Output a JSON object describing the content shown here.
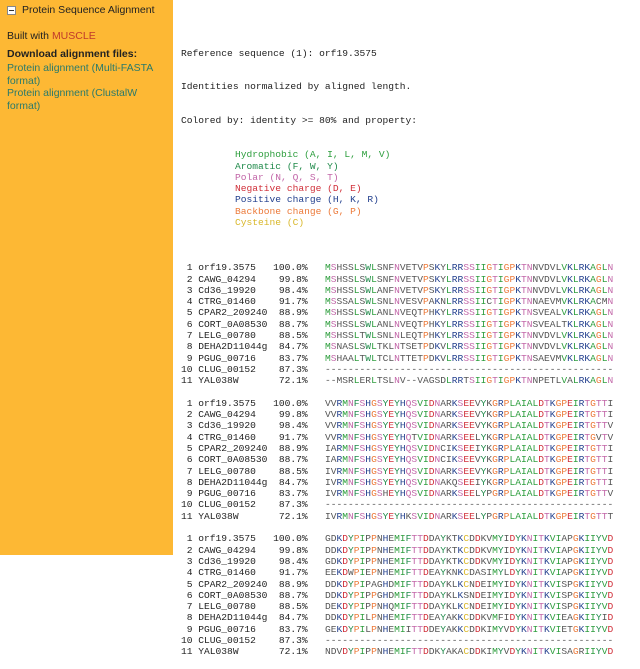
{
  "sidebar": {
    "title": "Protein Sequence Alignment",
    "built_with_prefix": "Built with ",
    "built_with_tool": "MUSCLE",
    "download_heading": "Download alignment files:",
    "links": [
      "Protein alignment (Multi-FASTA format)",
      "Protein alignment (ClustalW format)"
    ]
  },
  "header": {
    "reference": "Reference sequence (1): orf19.3575",
    "normalized": "Identities normalized by aligned length.",
    "colored_by": "Colored by: identity >= 80% and property:"
  },
  "legend": [
    {
      "label": "Hydrophobic (A, I, L, M, V)",
      "color": "#2e9e3e",
      "residues": "AILMV"
    },
    {
      "label": "Aromatic (F, W, Y)",
      "color": "#1f8a4a",
      "residues": "FWY"
    },
    {
      "label": "Polar (N, Q, S, T)",
      "color": "#c266a8",
      "residues": "NQST"
    },
    {
      "label": "Negative charge (D, E)",
      "color": "#d0303a",
      "residues": "DE"
    },
    {
      "label": "Positive charge (H, K, R)",
      "color": "#23408e",
      "residues": "HKR"
    },
    {
      "label": "Backbone change (G, P)",
      "color": "#ec7a3a",
      "residues": "GP"
    },
    {
      "label": "Cysteine (C)",
      "color": "#d9b82b",
      "residues": "C"
    }
  ],
  "default_color": "#555555",
  "identity_threshold": 0.8,
  "sequences": [
    {
      "num": "1",
      "name": "orf19.3575",
      "identity": "100.0%"
    },
    {
      "num": "2",
      "name": "CAWG_04294",
      "identity": "99.8%"
    },
    {
      "num": "3",
      "name": "Cd36_19920",
      "identity": "98.4%"
    },
    {
      "num": "4",
      "name": "CTRG_01460",
      "identity": "91.7%"
    },
    {
      "num": "5",
      "name": "CPAR2_209240",
      "identity": "88.9%"
    },
    {
      "num": "6",
      "name": "CORT_0A08530",
      "identity": "88.7%"
    },
    {
      "num": "7",
      "name": "LELG_00780",
      "identity": "88.5%"
    },
    {
      "num": "8",
      "name": "DEHA2D11044g",
      "identity": "84.7%"
    },
    {
      "num": "9",
      "name": "PGUG_00716",
      "identity": "83.7%"
    },
    {
      "num": "10",
      "name": "CLUG_00152",
      "identity": "87.3%"
    },
    {
      "num": "11",
      "name": "YAL038W",
      "identity": "72.1%"
    }
  ],
  "blocks": [
    [
      "MSHSSLSWLSNFNVETVPSKYLRRSSIIGTIGPKTNNVDVLVKLRKAGLN",
      "MSHSSLSWLSNFNVETVPSKYLRRSSIIGTIGPKTNNVDVLVKLRKAGLN",
      "MSHSSLSWLANFNVETVPSKYLRRSSIIGTIGPKTNNVDVLVKLRKAGLN",
      "MSSSALSWLSNLNVESVPAKNLRRSSIICTIGPKTNNAEVMVKLRKACMN",
      "MSHSSLSWLANLNVEQTPHKYLRRSSIIGTIGPKTNSVEALVKLRKAGLN",
      "MSHSSLSWLANLNVEQTPHKYLRRSSIIGTIGPKTNSVEALTKLRKAGLN",
      "MSHSSLTWLSNLNLEQTPHKYLRRSSIIGTIGPKTNNVDVLVKLRKAGLN",
      "MSNASLSWLTKLNTSETPDKVLRRSSIIGTIGPKTNNVDVLVKLRKAGLN",
      "MSHAALTWLTCLNTTETPDKVLRRSSIIGTIGPKTNSAEVMVKLRKAGLN",
      "--------------------------------------------------",
      "--MSRLERLTSLNV--VAGSDLRRTSIIGTIGPKTNNPETLVALRKAGLN"
    ],
    [
      "VVRMNFSHGSYEYHQSVIDNARKSEEVYKGRPLAIALDTKGPEIRTGTTI",
      "VVRMNFSHGSYEYHQSVIDNARKSEEVYKGRPLAIALDTKGPEIRTGTTI",
      "VVRMNFSHGSYEYHQSVIDNARKSEEVYKGRPLAIALDTKGPEIRTGTTV",
      "VVRMNFSHGSYEYHQTVIDNARKSEELYKGRPLAIALDTKGPEIRTGVTV",
      "IARMNFSHGSYEYHQSVIDNCIKSEEIYKGRPLAIALDTKGPEIRTGTTI",
      "IARMNFSHGSYEYHQSVIDNCIKSEEVYKGRPLAIALDTKGPEIRTGTTI",
      "IVRMNFSHGSYEYHQSVIDNARKSEEVYKGRPLAIALDTKGPEIRTGTTI",
      "IVRMNFSHGSYEYHQSVIDNAKQSEEIYKGRPLAIALDTKGPEIRTGTTI",
      "IVRMNFSHGSHEYHQSVIDNARKSEELYPGRPLAIALDTKGPEIRTGTTV",
      "--------------------------------------------------",
      "IVRMNFSHGSYEYHKSVIDNARKSEELYPGRPLAIALDTKGPEIRTGTTT"
    ],
    [
      "GDKDYPIPPNHEMIFTTDDAYKTKCDDKVMYIDYKNITKVIAPGKIIYVD",
      "DDKDYPIPPNHEMIFTTDDAYKTKCDDKVMYIDYKNITKVIAPGKIIYVD",
      "GDKDYPIPPNHEMIFTTDDAYKTKCDDKVMYIDYKNITKVIAPGKIIYVD",
      "EEKDWPIEPNHEMIFTTDEAYKNKCDASIMYLDYKNITKVIAPGKIIYVD",
      "DDKDYPIPAGHDMIFTTDDAYKLKCNDEIMYIDYKNITKVISPGKIIYVD",
      "DDKDYPIPPGHDMIFTTDDAYKLKSNDEIMYIDYKNITKVISPGKIIYVD",
      "DEKDYPIPPNHQMIFTTDDAYKLKCNDEIMYIDYKNITKVISPGKIIYVD",
      "DDKDYPILPNHEMIFTTDEAYAKKCDDKVMFIDYKNITKVIEAGKIIYID",
      "GEKDYPILPNHEMIITTDDEYAKKCDDKIMYVDYKNITKVIETGKIIYVD",
      "--------------------------------------------------",
      "NDVDYPIPPNHEMIFTTDDKYAKACDDKIMYVDYKNITKVISAGRIIYVD"
    ]
  ]
}
